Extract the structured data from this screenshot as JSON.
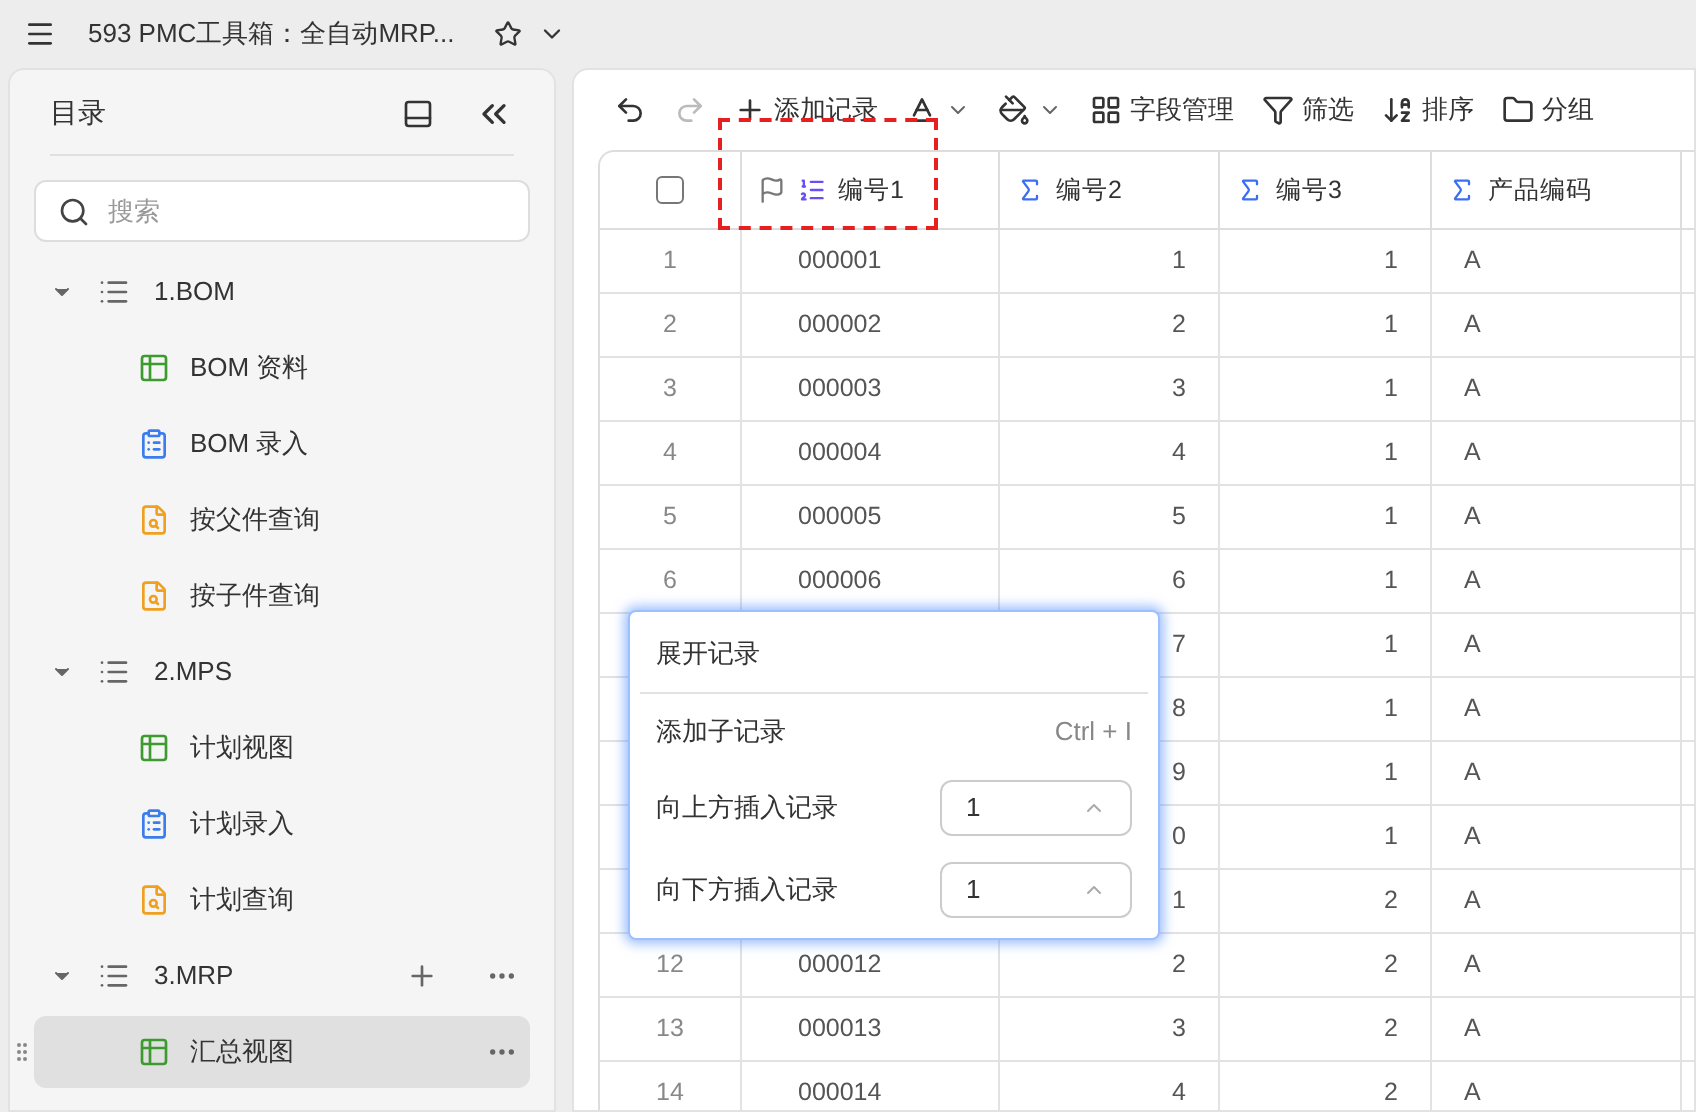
{
  "title_bar": {
    "title": "593 PMC工具箱：全自动MRP..."
  },
  "sidebar": {
    "title": "目录",
    "search": {
      "placeholder": "搜索"
    },
    "items": [
      {
        "label": "1.BOM",
        "kind": "folder",
        "expanded": true,
        "selected": false,
        "hovered": false,
        "children": [
          {
            "label": "BOM 资料",
            "kind": "table",
            "selected": false
          },
          {
            "label": "BOM 录入",
            "kind": "form",
            "selected": false
          },
          {
            "label": "按父件查询",
            "kind": "query",
            "selected": false
          },
          {
            "label": "按子件查询",
            "kind": "query",
            "selected": false
          }
        ]
      },
      {
        "label": "2.MPS",
        "kind": "folder",
        "expanded": true,
        "selected": false,
        "hovered": false,
        "children": [
          {
            "label": "计划视图",
            "kind": "table",
            "selected": false
          },
          {
            "label": "计划录入",
            "kind": "form",
            "selected": false
          },
          {
            "label": "计划查询",
            "kind": "query",
            "selected": false
          }
        ]
      },
      {
        "label": "3.MRP",
        "kind": "folder",
        "expanded": true,
        "selected": false,
        "hovered": true,
        "children": [
          {
            "label": "汇总视图",
            "kind": "table",
            "selected": true
          }
        ]
      }
    ]
  },
  "toolbar": [
    {
      "label": "添加记录",
      "kind": "add"
    },
    {
      "kind": "text-color"
    },
    {
      "kind": "fill-color"
    },
    {
      "label": "字段管理",
      "kind": "fields"
    },
    {
      "label": "筛选",
      "kind": "filter"
    },
    {
      "label": "排序",
      "kind": "sort"
    },
    {
      "label": "分组",
      "kind": "group"
    }
  ],
  "table": {
    "select_all": {
      "checked": false
    },
    "columns": [
      {
        "label": "编号1",
        "kind": "autonumber",
        "primary": true
      },
      {
        "label": "编号2",
        "kind": "formula",
        "primary": false
      },
      {
        "label": "编号3",
        "kind": "formula",
        "primary": false
      },
      {
        "label": "产品编码",
        "kind": "formula",
        "primary": false
      }
    ],
    "rows": [
      {
        "index": "1",
        "cells": [
          "000001",
          "1",
          "1",
          "A"
        ]
      },
      {
        "index": "2",
        "cells": [
          "000002",
          "2",
          "1",
          "A"
        ]
      },
      {
        "index": "3",
        "cells": [
          "000003",
          "3",
          "1",
          "A"
        ]
      },
      {
        "index": "4",
        "cells": [
          "000004",
          "4",
          "1",
          "A"
        ]
      },
      {
        "index": "5",
        "cells": [
          "000005",
          "5",
          "1",
          "A"
        ]
      },
      {
        "index": "6",
        "cells": [
          "000006",
          "6",
          "1",
          "A"
        ]
      },
      {
        "cells": [
          null,
          "7",
          "1",
          "A"
        ]
      },
      {
        "cells": [
          null,
          "8",
          "1",
          "A"
        ]
      },
      {
        "cells": [
          null,
          "9",
          "1",
          "A"
        ]
      },
      {
        "cells": [
          null,
          "0",
          "1",
          "A"
        ]
      },
      {
        "cells": [
          null,
          "1",
          "2",
          "A"
        ]
      },
      {
        "index": "12",
        "cells": [
          "000012",
          "2",
          "2",
          "A"
        ]
      },
      {
        "index": "13",
        "cells": [
          "000013",
          "3",
          "2",
          "A"
        ]
      },
      {
        "index": "14",
        "cells": [
          "000014",
          "4",
          "2",
          "A"
        ]
      }
    ]
  },
  "context_menu": {
    "items": [
      {
        "kind": "action",
        "label": "展开记录"
      },
      {
        "kind": "action",
        "label": "添加子记录",
        "shortcut": "Ctrl + I"
      },
      {
        "kind": "number",
        "label": "向上方插入记录",
        "value": "1"
      },
      {
        "kind": "number",
        "label": "向下方插入记录",
        "value": "1"
      }
    ]
  }
}
